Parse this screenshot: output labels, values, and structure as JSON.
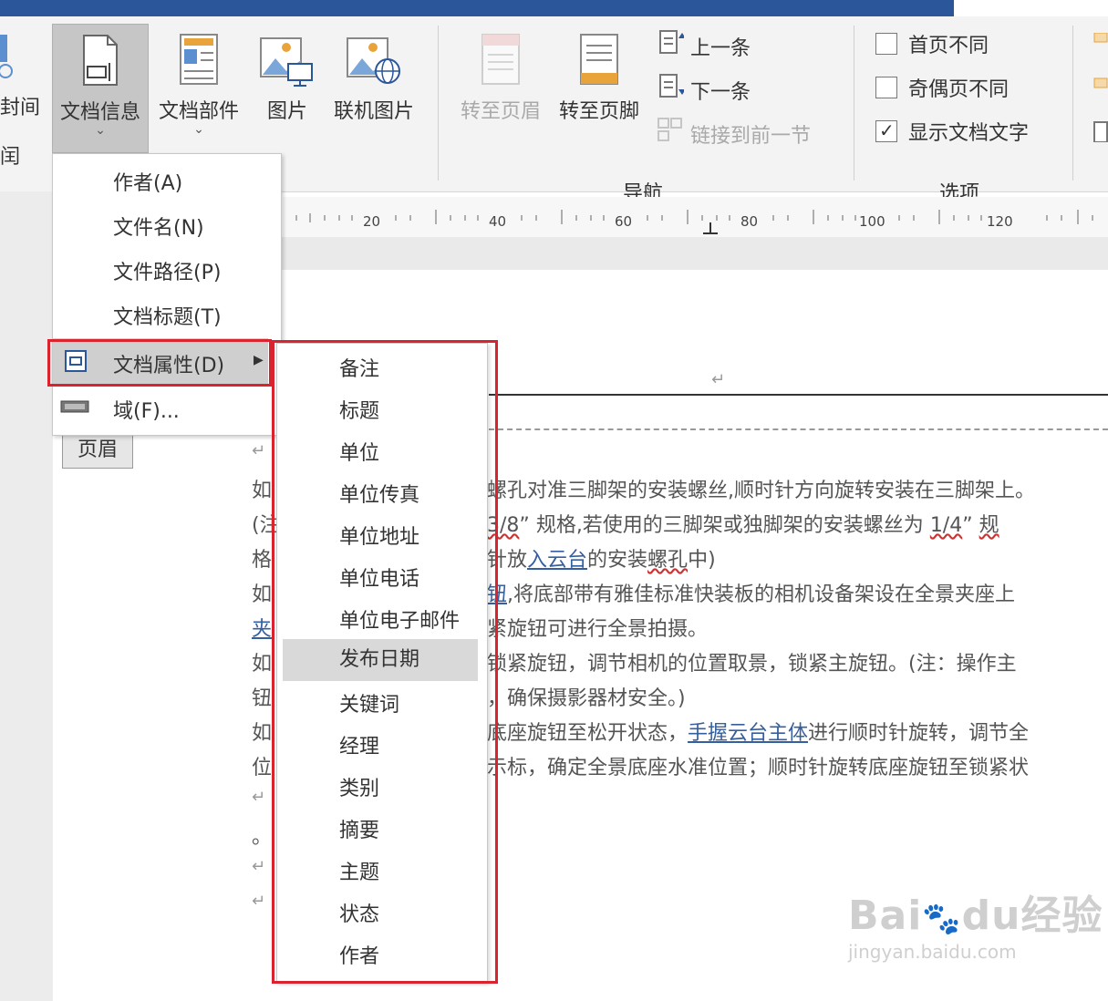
{
  "ribbon": {
    "partial_left_label": "封间",
    "partial_left_char": "闰",
    "buttons": [
      {
        "label": "文档信息",
        "chevron": "⌄"
      },
      {
        "label": "文档部件",
        "chevron": "⌄"
      },
      {
        "label": "图片"
      },
      {
        "label": "联机图片"
      }
    ],
    "navigation": {
      "goto_header": "转至页眉",
      "goto_footer": "转至页脚",
      "previous": "上一条",
      "next": "下一条",
      "link_previous": "链接到前一节",
      "group_label": "导航"
    },
    "options": {
      "different_first_page": "首页不同",
      "different_odd_even": "奇偶页不同",
      "show_document_text": "显示文档文字",
      "group_label": "选项"
    }
  },
  "ruler": {
    "ticks": [
      "20",
      "40",
      "60",
      "80",
      "100",
      "120"
    ]
  },
  "dropdown": {
    "items": [
      "作者(A)",
      "文件名(N)",
      "文件路径(P)",
      "文档标题(T)",
      "文档属性(D)",
      "域(F)..."
    ]
  },
  "submenu": {
    "items": [
      "备注",
      "标题",
      "单位",
      "单位传真",
      "单位地址",
      "单位电话",
      "单位电子邮件",
      "发布日期",
      "关键词",
      "经理",
      "类别",
      "摘要",
      "主题",
      "状态",
      "作者"
    ],
    "highlighted": "发布日期"
  },
  "header_tag": "页眉",
  "document": {
    "paragraph_mark": "↵",
    "left_fragments": [
      "如",
      "(注",
      "格",
      "如",
      "夹",
      "如",
      "钮",
      "如",
      "位",
      "。"
    ],
    "lines": [
      "螺孔对准三脚架的安装螺丝,顺时针方向旋转安装在三脚架上。",
      "3/8",
      "规格,若使用的三脚架或独脚架的安装螺丝为",
      "1/4",
      "规",
      "针放",
      "入云台",
      "的安装",
      "螺孔",
      "中)",
      "钮",
      ",将底部带有雅佳标准快装板的相机设备架设在全景夹座上",
      "紧旋钮可进行全景拍摄。",
      "锁紧旋钮，调节相机的位置取景，锁紧主旋钮。(注：操作主",
      "，确保摄影器材安全。)",
      "底座旋钮至松开状态，",
      "手握云台主体",
      "进行顺时针旋转，调节全",
      "示标，确定全景底座水准位置；顺时针旋转底座旋钮至锁紧状"
    ]
  },
  "watermark": {
    "brand": "Bai",
    "brand2": "du",
    "brand_cn": "经验",
    "url": "jingyan.baidu.com"
  },
  "colors": {
    "accent": "#2b579a",
    "highlight_box": "#d9232e",
    "link": "#355f9e"
  }
}
